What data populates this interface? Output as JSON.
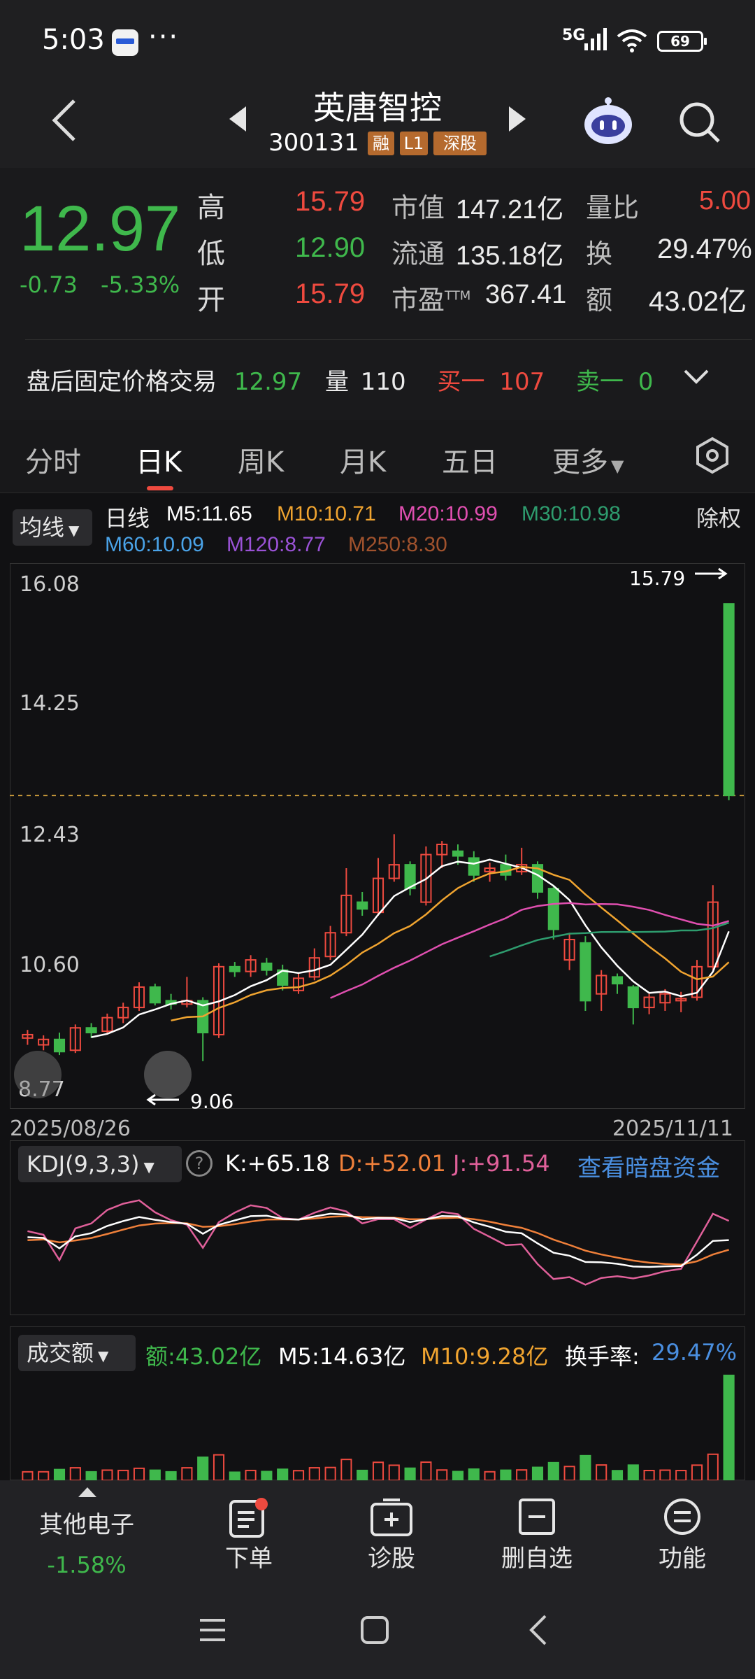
{
  "status_bar": {
    "time": "5:03",
    "dots": "···",
    "network": "5G",
    "battery": "69",
    "icons": [
      "app-notification-icon",
      "signal-icon",
      "wifi-icon",
      "battery-icon"
    ]
  },
  "header": {
    "stock_name": "英唐智控",
    "stock_code": "300131",
    "tags": [
      "融",
      "L1",
      "深股"
    ],
    "icons": [
      "back-icon",
      "prev-stock-icon",
      "next-stock-icon",
      "robot-assistant-icon",
      "search-icon"
    ]
  },
  "quote": {
    "price": "12.97",
    "change": "-0.73",
    "change_pct": "-5.33%",
    "high_label": "高",
    "high": "15.79",
    "low_label": "低",
    "low": "12.90",
    "open_label": "开",
    "open": "15.79",
    "mktcap_label": "市值",
    "mktcap": "147.21亿",
    "float_label": "流通",
    "float": "135.18亿",
    "pe_label": "市盈",
    "pe_suffix": "TTM",
    "pe": "367.41",
    "volratio_label": "量比",
    "volratio": "5.00",
    "turnover_label": "换",
    "turnover": "29.47%",
    "amount_label": "额",
    "amount": "43.02亿"
  },
  "afterhours": {
    "label": "盘后固定价格交易",
    "price": "12.97",
    "vol_label": "量",
    "vol": "110",
    "bid_label": "买一",
    "bid": "107",
    "ask_label": "卖一",
    "ask": "0"
  },
  "tabs": [
    "分时",
    "日K",
    "周K",
    "月K",
    "五日",
    "更多"
  ],
  "active_tab": "日K",
  "ma_legend": {
    "selector": "均线",
    "period_label": "日线",
    "m5": "M5:11.65",
    "m10": "M10:10.71",
    "m20": "M20:10.99",
    "m30": "M30:10.98",
    "m60": "M60:10.09",
    "m120": "M120:8.77",
    "m250": "M250:8.30",
    "exright": "除权"
  },
  "kdj": {
    "selector": "KDJ(9,3,3)",
    "help": "?",
    "k": "K:+65.18",
    "d": "D:+52.01",
    "j": "J:+91.54",
    "dark_pool_link": "查看暗盘资金"
  },
  "volume_panel": {
    "selector": "成交额",
    "amount": "额:43.02亿",
    "m5": "M5:14.63亿",
    "m10": "M10:9.28亿",
    "turnover_label": "换手率:",
    "turnover": "29.47%"
  },
  "toolbar": {
    "sector_name": "其他电子",
    "sector_change": "-1.58%",
    "order": "下单",
    "diagnose": "诊股",
    "remove_watch": "删自选",
    "functions": "功能"
  },
  "colors": {
    "up": "#ef4a3f",
    "down": "#3fb84c",
    "m5": "#ffffff",
    "m10": "#f0a430",
    "m20": "#e04fb0",
    "m30": "#2e9c6e",
    "m60": "#4aa3e8",
    "m120": "#9a52d6",
    "m250": "#a0522d"
  },
  "chart_data": {
    "type": "candlestick",
    "x_start_label": "2025/08/26",
    "x_end_label": "2025/11/11",
    "y_ticks": [
      "16.08",
      "14.25",
      "12.43",
      "10.60",
      "8.77"
    ],
    "max_marker": "15.79",
    "min_marker": "9.06",
    "last_close": 12.97,
    "candles": [
      [
        9.4,
        9.45,
        9.52,
        9.3
      ],
      [
        9.3,
        9.38,
        9.44,
        9.22
      ],
      [
        9.38,
        9.2,
        9.48,
        9.15
      ],
      [
        9.22,
        9.55,
        9.6,
        9.18
      ],
      [
        9.55,
        9.48,
        9.62,
        9.4
      ],
      [
        9.5,
        9.7,
        9.76,
        9.45
      ],
      [
        9.7,
        9.85,
        9.92,
        9.62
      ],
      [
        9.85,
        10.15,
        10.22,
        9.8
      ],
      [
        10.15,
        9.92,
        10.2,
        9.88
      ],
      [
        9.95,
        9.9,
        10.05,
        9.82
      ],
      [
        9.9,
        9.95,
        10.3,
        9.85
      ],
      [
        9.95,
        9.48,
        10.0,
        9.06
      ],
      [
        9.45,
        10.45,
        10.5,
        9.4
      ],
      [
        10.45,
        10.38,
        10.52,
        10.3
      ],
      [
        10.38,
        10.55,
        10.62,
        10.3
      ],
      [
        10.5,
        10.4,
        10.58,
        10.32
      ],
      [
        10.4,
        10.18,
        10.48,
        10.1
      ],
      [
        10.1,
        10.28,
        10.35,
        10.05
      ],
      [
        10.3,
        10.58,
        10.72,
        10.25
      ],
      [
        10.6,
        10.95,
        11.05,
        10.55
      ],
      [
        10.95,
        11.5,
        11.9,
        10.9
      ],
      [
        11.4,
        11.3,
        11.55,
        11.2
      ],
      [
        11.25,
        11.75,
        12.05,
        11.2
      ],
      [
        11.75,
        11.95,
        12.4,
        11.7
      ],
      [
        11.95,
        11.6,
        12.0,
        11.5
      ],
      [
        11.4,
        12.1,
        12.22,
        11.35
      ],
      [
        12.1,
        12.25,
        12.3,
        11.9
      ],
      [
        12.15,
        12.08,
        12.25,
        11.95
      ],
      [
        12.05,
        11.8,
        12.15,
        11.7
      ],
      [
        11.85,
        11.9,
        11.98,
        11.7
      ],
      [
        11.95,
        11.8,
        12.1,
        11.72
      ],
      [
        11.85,
        11.95,
        12.2,
        11.8
      ],
      [
        11.95,
        11.55,
        12.0,
        11.45
      ],
      [
        11.6,
        11.0,
        11.65,
        10.85
      ],
      [
        10.55,
        10.85,
        10.95,
        10.4
      ],
      [
        10.8,
        9.95,
        10.9,
        9.8
      ],
      [
        10.05,
        10.32,
        10.4,
        9.8
      ],
      [
        10.3,
        10.2,
        10.35,
        10.05
      ],
      [
        10.15,
        9.85,
        10.18,
        9.6
      ],
      [
        9.85,
        10.0,
        10.05,
        9.75
      ],
      [
        9.92,
        10.05,
        10.12,
        9.8
      ],
      [
        9.95,
        9.98,
        10.08,
        9.78
      ],
      [
        10.0,
        10.45,
        10.55,
        9.95
      ],
      [
        10.45,
        11.4,
        11.65,
        10.4
      ],
      [
        15.79,
        12.97,
        15.79,
        12.9
      ]
    ]
  }
}
